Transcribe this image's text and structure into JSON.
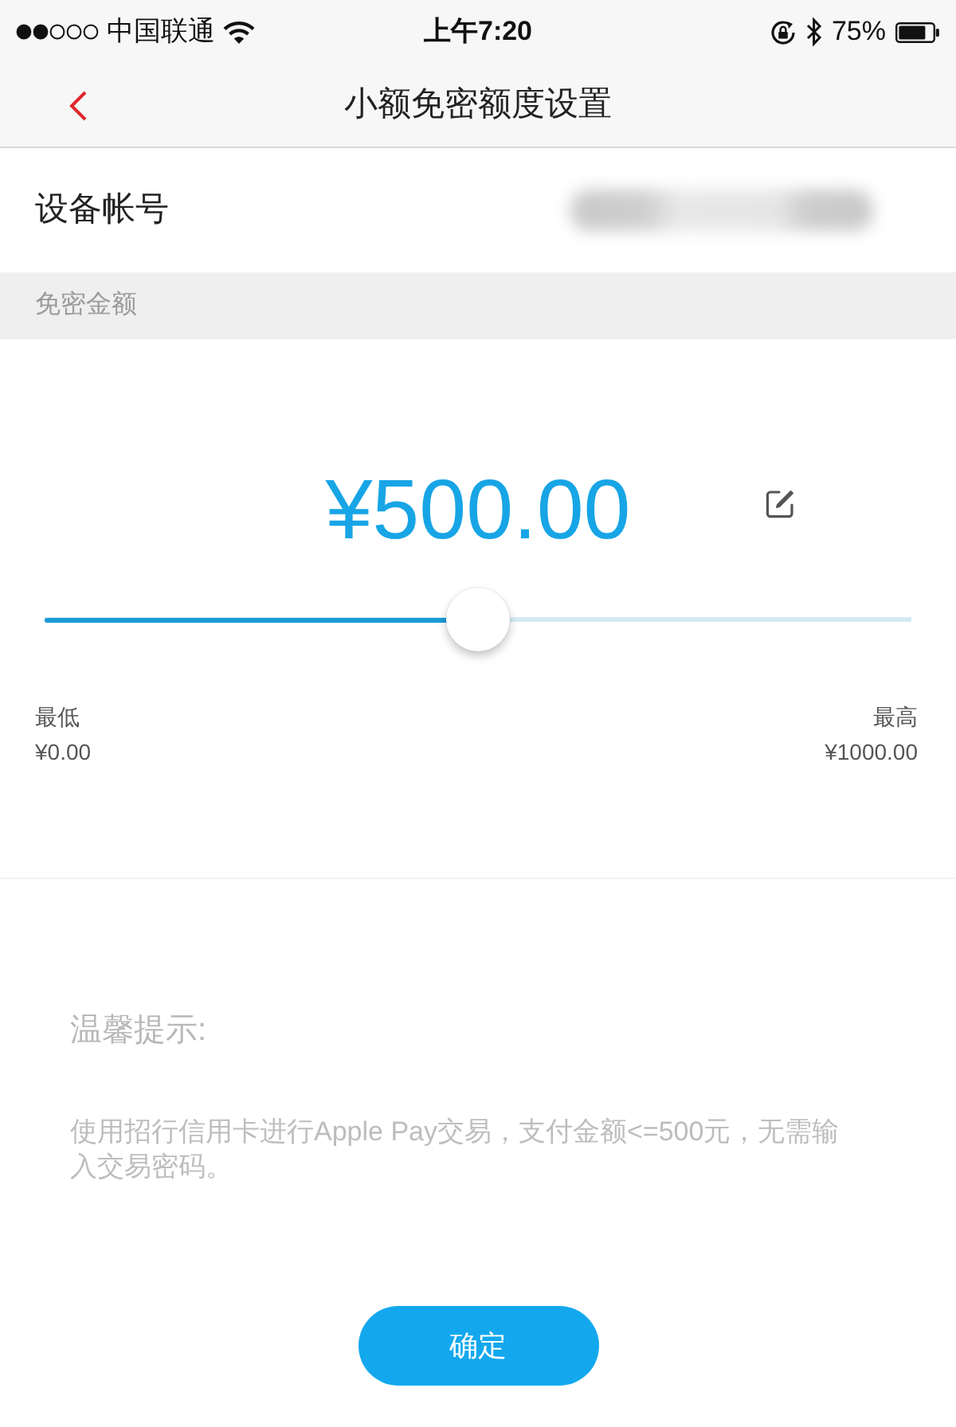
{
  "status_bar": {
    "carrier": "中国联通",
    "time": "上午7:20",
    "battery": "75%"
  },
  "nav_bar": {
    "title": "小额免密额度设置"
  },
  "account": {
    "label": "设备帐号"
  },
  "section": {
    "title": "免密金额"
  },
  "amount": {
    "value": "¥500.00",
    "slider": {
      "level": 0.5
    },
    "min": {
      "label": "最低",
      "value": "¥0.00"
    },
    "max": {
      "label": "最高",
      "value": "¥1000.00"
    }
  },
  "tip": {
    "title": "温馨提示:",
    "text": "使用招行信用卡进行Apple Pay交易，支付金额<=500元，无需输入交易密码。"
  },
  "confirm_button": {
    "label": "确定"
  }
}
